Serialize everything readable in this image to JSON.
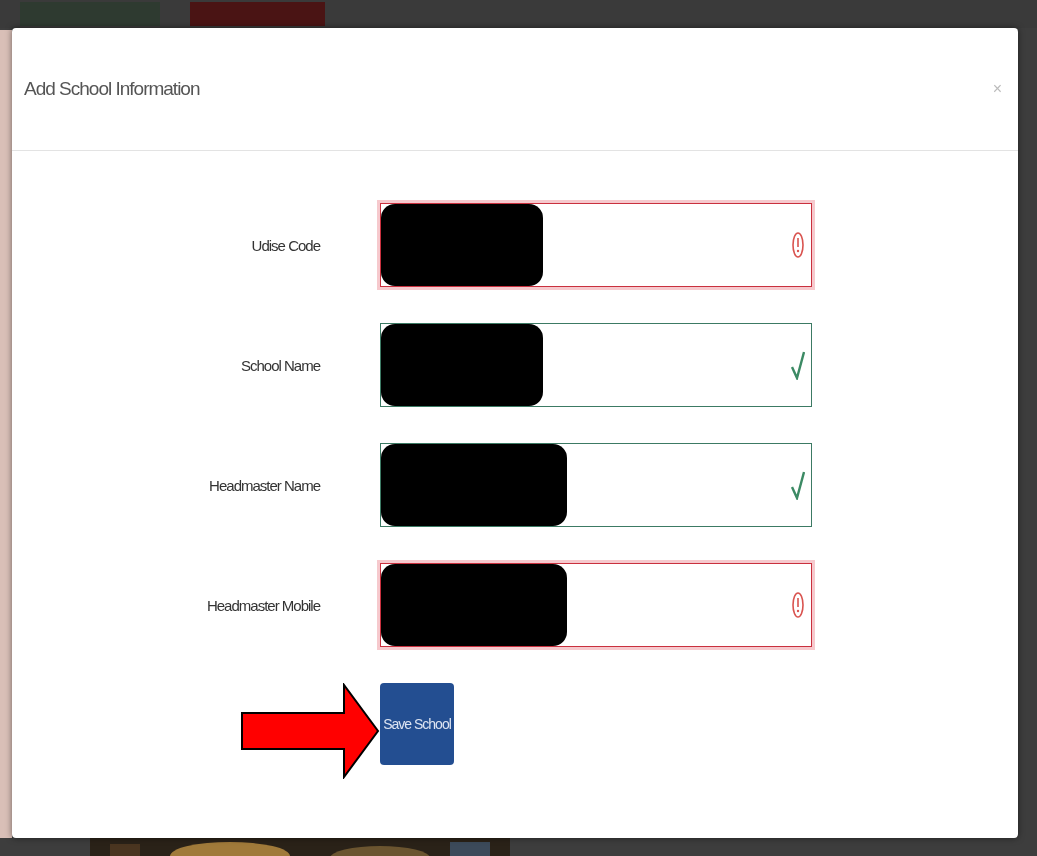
{
  "dialog": {
    "title": "Add School Information",
    "close": "×"
  },
  "fields": [
    {
      "label": "Udise Code",
      "valid": false,
      "redacted": true
    },
    {
      "label": "School Name",
      "valid": true,
      "redacted": true
    },
    {
      "label": "Headmaster Name",
      "valid": true,
      "redacted": true
    },
    {
      "label": "Headmaster Mobile",
      "valid": false,
      "redacted": true
    }
  ],
  "save_button": {
    "label": "Save School"
  },
  "annotation": {
    "kind": "arrow",
    "color": "#ff0000"
  }
}
